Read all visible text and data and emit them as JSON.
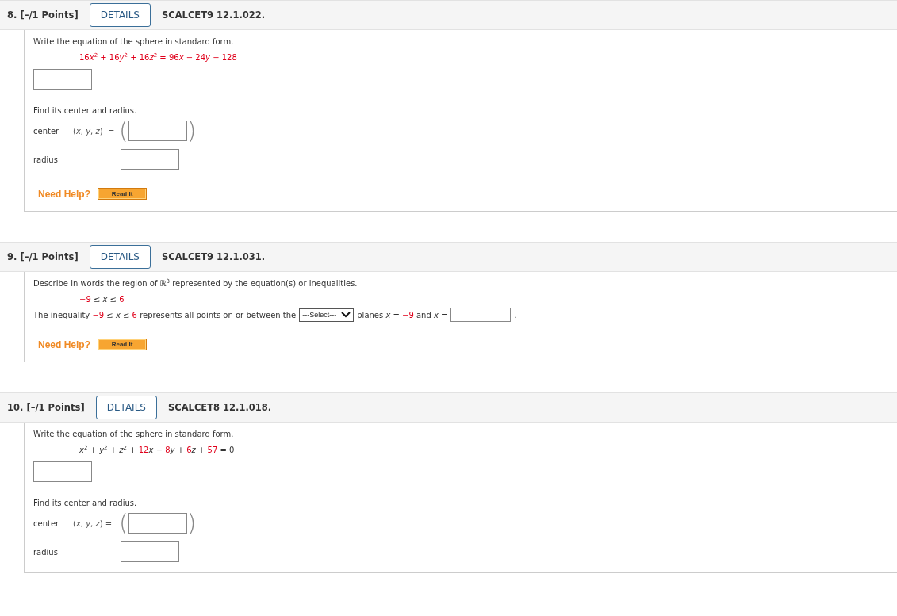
{
  "problems": [
    {
      "number": "8.",
      "points": "[–/1 Points]",
      "details": "DETAILS",
      "code": "SCALCET9 12.1.022.",
      "body": [
        {
          "kind": "line",
          "parts": [
            {
              "kind": "plain",
              "text": "Write the equation of the sphere in standard form."
            }
          ]
        },
        {
          "kind": "equation",
          "parts": [
            {
              "kind": "given",
              "text": "16"
            },
            {
              "kind": "given",
              "text": "*x*$^{2}$ + 16"
            },
            {
              "kind": "given",
              "text": "*y*$^{2}$ + 16"
            },
            {
              "kind": "given",
              "text": "*z*$^{2}$ = 96"
            },
            {
              "kind": "given",
              "text": "*x* − 24"
            },
            {
              "kind": "given",
              "text": "*y* − 128"
            }
          ]
        },
        {
          "kind": "answer"
        },
        {
          "kind": "line",
          "parts": [
            {
              "kind": "plain",
              "text": "Find its center and radius."
            }
          ]
        },
        {
          "kind": "center",
          "label": "center",
          "vars": "(*x*, *y*, *z*)  =",
          "open": "(",
          "close": ")"
        },
        {
          "kind": "radius",
          "label": "radius"
        },
        {
          "kind": "help",
          "label": "Need Help?",
          "button": "Read It"
        }
      ]
    },
    {
      "number": "9.",
      "points": "[–/1 Points]",
      "details": "DETAILS",
      "code": "SCALCET9 12.1.031.",
      "body": [
        {
          "kind": "line",
          "parts": [
            {
              "kind": "plain",
              "text": "Describe in words the region of ℝ$^{3}$ represented by the equation(s) or inequalities."
            }
          ]
        },
        {
          "kind": "equation",
          "parts": [
            {
              "kind": "given",
              "text": "−9"
            },
            {
              "kind": "plain",
              "text": " ≤ *x* ≤ "
            },
            {
              "kind": "given",
              "text": "6"
            }
          ]
        },
        {
          "kind": "line",
          "parts": [
            {
              "kind": "plain",
              "text": "The inequality "
            },
            {
              "kind": "given",
              "text": "−9"
            },
            {
              "kind": "plain",
              "text": " ≤ *x* ≤ "
            },
            {
              "kind": "given",
              "text": "6"
            },
            {
              "kind": "plain",
              "text": " represents all points on or between the"
            },
            {
              "kind": "select",
              "text": "---Select---"
            },
            {
              "kind": "plain",
              "text": "planes *x* = "
            },
            {
              "kind": "given",
              "text": "−9"
            },
            {
              "kind": "plain",
              "text": " and *x* ="
            },
            {
              "kind": "input"
            },
            {
              "kind": "plain",
              "text": "."
            }
          ]
        },
        {
          "kind": "help",
          "label": "Need Help?",
          "button": "Read It"
        }
      ]
    },
    {
      "number": "10.",
      "points": "[–/1 Points]",
      "details": "DETAILS",
      "code": "SCALCET8 12.1.018.",
      "body": [
        {
          "kind": "line",
          "parts": [
            {
              "kind": "plain",
              "text": "Write the equation of the sphere in standard form."
            }
          ]
        },
        {
          "kind": "equation",
          "parts": [
            {
              "kind": "plain",
              "text": "*x*$^{2}$ + *y*$^{2}$ + *z*$^{2}$ + "
            },
            {
              "kind": "given",
              "text": "12"
            },
            {
              "kind": "plain",
              "text": "*x* − "
            },
            {
              "kind": "given",
              "text": "8"
            },
            {
              "kind": "plain",
              "text": "*y* + "
            },
            {
              "kind": "given",
              "text": "6"
            },
            {
              "kind": "plain",
              "text": "*z* + "
            },
            {
              "kind": "given",
              "text": "57"
            },
            {
              "kind": "plain",
              "text": " = 0"
            }
          ]
        },
        {
          "kind": "answer"
        },
        {
          "kind": "line",
          "parts": [
            {
              "kind": "plain",
              "text": "Find its center and radius."
            }
          ]
        },
        {
          "kind": "center",
          "label": "center",
          "vars": "(*x*, *y*, *z*) =",
          "open": "(",
          "close": ")"
        },
        {
          "kind": "radius",
          "label": "radius"
        }
      ]
    }
  ]
}
